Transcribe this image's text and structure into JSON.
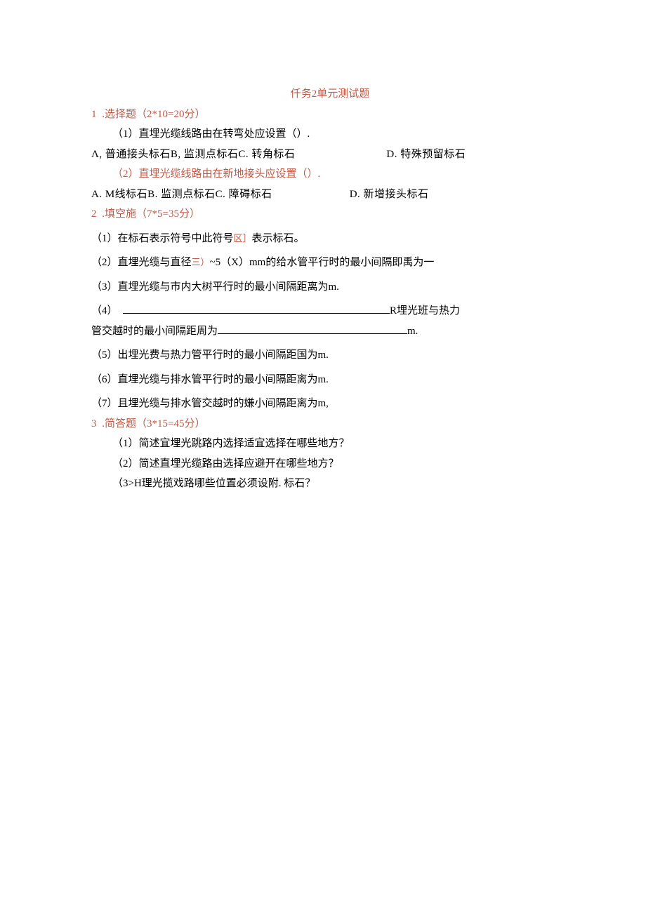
{
  "title": "仟务2单元测试题",
  "sections": {
    "s1": {
      "num": "1",
      "head": " .选择题（2*10=20分）",
      "q1": "（1）直埋光缆线路由在转弯处应设置（）.",
      "q1optsL": "Λ, 普通接头标石B, 监测点标石C. 转角标石",
      "q1optsR": "D. 特殊预留标石",
      "q2": "（2）直埋光缆线路由在新地接头应设置（）.",
      "q2optsL": "A. M线标石B. 监测点标石C. 障碍标石",
      "q2optsR": "D. 新增接头标石"
    },
    "s2": {
      "num": "2",
      "head": " .填空施（7*5=35分）",
      "f1a": "（1）在标石表示符号中此符号",
      "f1sym": "区］",
      "f1b": "表示标石。",
      "f2a": "（2）直埋光缆与直径",
      "f2sym": "三）",
      "f2b": "~5（X）mm的给水管平行时的最小间隔即禹为一",
      "f3": "（3）直埋光缆与市内大树平行时的最小间隔距离为m.",
      "f4a": "（4）",
      "f4b": "R埋光班与热力",
      "f4c": "管交越时的最小间隔距周为",
      "f4d": "m.",
      "f5": "（5）出埋光费与热力管平行时的最小间隔距国为m.",
      "f6": "（6）直埋光缆与排水管平行时的最小间隔距离为m.",
      "f7": "（7）且埋光缆与排水管交越时的嫌小间隔距离为m,"
    },
    "s3": {
      "num": "3",
      "head": " .简答题（3*15=45分）",
      "a1": "（1）简述宜埋光跳路内选择适宜选择在哪些地方？",
      "a2": "（2）简述直埋光缆路由选择应避开在哪些地方？",
      "a3": "（3>H理光揽戏路哪些位置必须设附. 标石？"
    }
  }
}
